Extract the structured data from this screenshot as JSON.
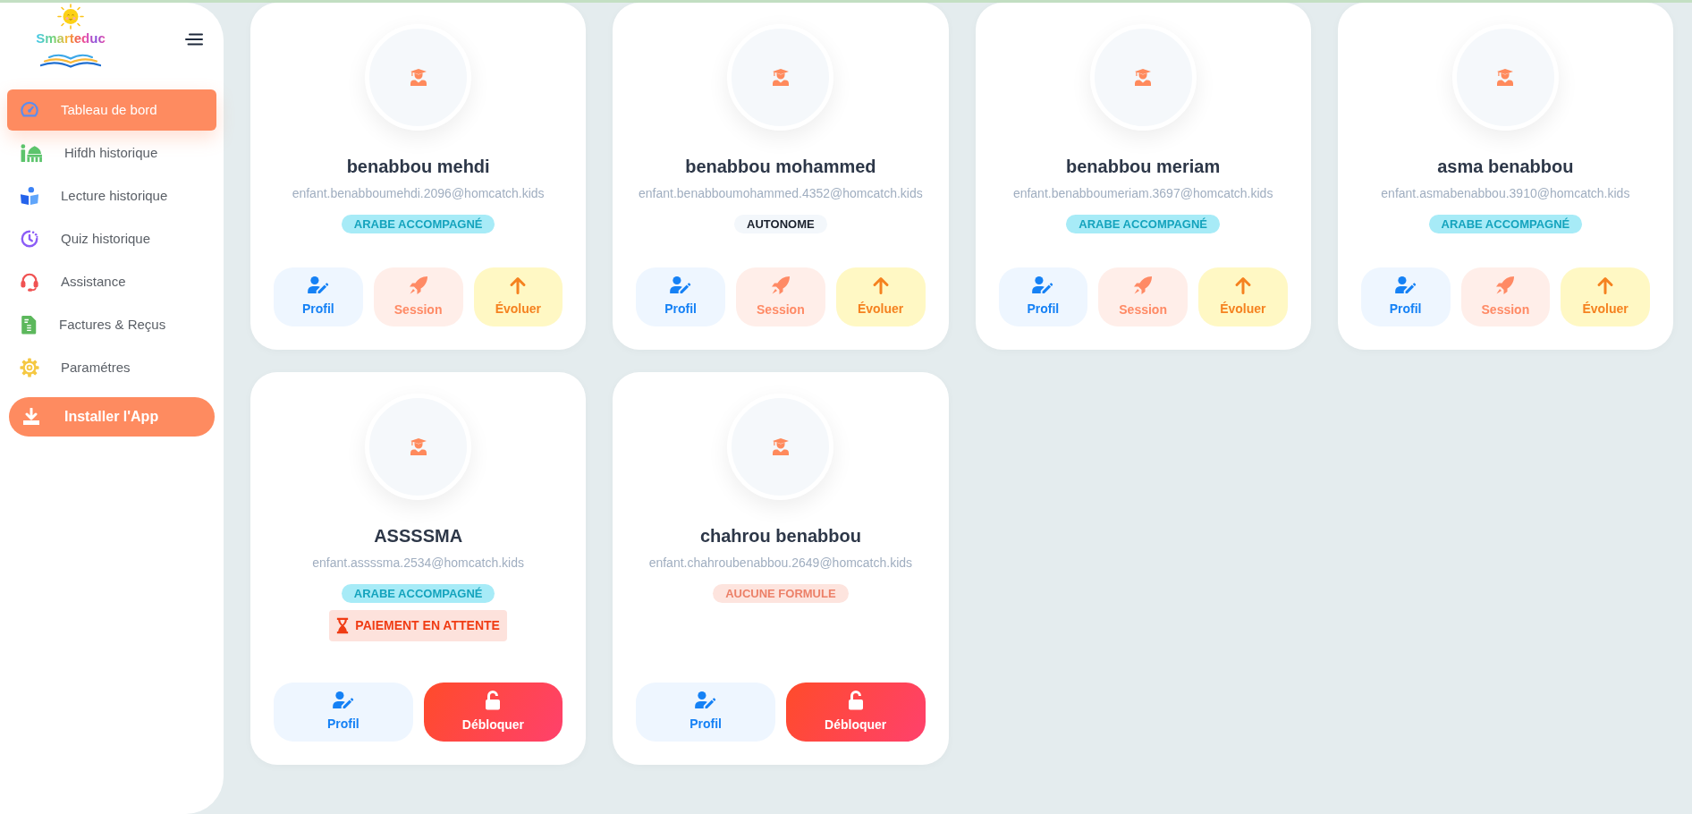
{
  "sidebar": {
    "logo": {
      "text": "Smarteduc"
    },
    "items": [
      {
        "label": "Tableau de bord",
        "selected": true
      },
      {
        "label": "Hifdh historique",
        "selected": false
      },
      {
        "label": "Lecture historique",
        "selected": false
      },
      {
        "label": "Quiz historique",
        "selected": false
      },
      {
        "label": "Assistance",
        "selected": false
      },
      {
        "label": "Factures & Reçus",
        "selected": false
      },
      {
        "label": "Paramétres",
        "selected": false
      }
    ],
    "install_button": {
      "label": "Installer l'App"
    }
  },
  "children": [
    {
      "name": "benabbou mehdi",
      "email": "enfant.benabboumehdi.2096@homcatch.kids",
      "plan": {
        "label": "ARABE ACCOMPAGNÉ",
        "kind": "accompanied"
      },
      "actions": [
        {
          "kind": "profile",
          "label": "Profil"
        },
        {
          "kind": "session",
          "label": "Session"
        },
        {
          "kind": "upgrade",
          "label": "Évoluer"
        }
      ]
    },
    {
      "name": "benabbou mohammed",
      "email": "enfant.benabboumohammed.4352@homcatch.kids",
      "plan": {
        "label": "AUTONOME",
        "kind": "autonomous"
      },
      "actions": [
        {
          "kind": "profile",
          "label": "Profil"
        },
        {
          "kind": "session",
          "label": "Session"
        },
        {
          "kind": "upgrade",
          "label": "Évoluer"
        }
      ]
    },
    {
      "name": "benabbou meriam",
      "email": "enfant.benabboumeriam.3697@homcatch.kids",
      "plan": {
        "label": "ARABE ACCOMPAGNÉ",
        "kind": "accompanied"
      },
      "actions": [
        {
          "kind": "profile",
          "label": "Profil"
        },
        {
          "kind": "session",
          "label": "Session"
        },
        {
          "kind": "upgrade",
          "label": "Évoluer"
        }
      ]
    },
    {
      "name": "asma benabbou",
      "email": "enfant.asmabenabbou.3910@homcatch.kids",
      "plan": {
        "label": "ARABE ACCOMPAGNÉ",
        "kind": "accompanied"
      },
      "actions": [
        {
          "kind": "profile",
          "label": "Profil"
        },
        {
          "kind": "session",
          "label": "Session"
        },
        {
          "kind": "upgrade",
          "label": "Évoluer"
        }
      ]
    },
    {
      "name": "ASSSSMA",
      "email": "enfant.assssma.2534@homcatch.kids",
      "plan": {
        "label": "ARABE ACCOMPAGNÉ",
        "kind": "accompanied"
      },
      "payment_status": {
        "label": "PAIEMENT EN ATTENTE"
      },
      "actions": [
        {
          "kind": "profile",
          "label": "Profil"
        },
        {
          "kind": "unlock",
          "label": "Débloquer"
        }
      ]
    },
    {
      "name": "chahrou benabbou",
      "email": "enfant.chahroubenabbou.2649@homcatch.kids",
      "plan": {
        "label": "AUCUNE FORMULE",
        "kind": "none"
      },
      "actions": [
        {
          "kind": "profile",
          "label": "Profil"
        },
        {
          "kind": "unlock",
          "label": "Débloquer"
        }
      ]
    }
  ]
}
